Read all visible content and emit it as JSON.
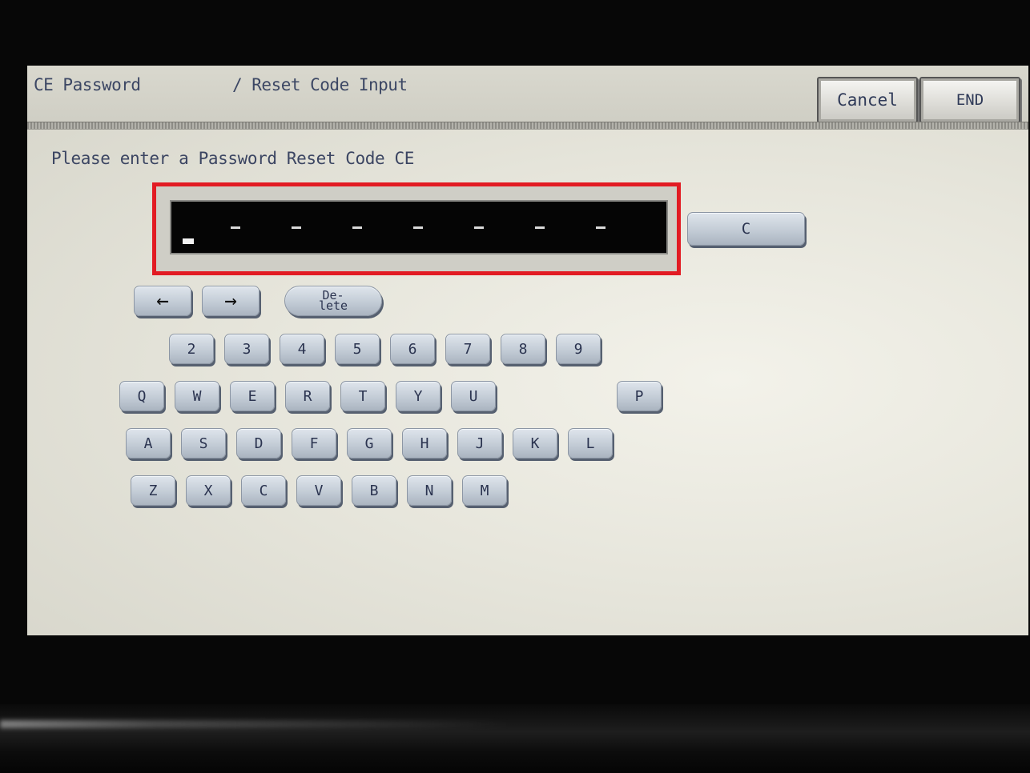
{
  "header": {
    "crumb_primary": "CE Password",
    "crumb_secondary": "/ Reset Code Input",
    "cancel_label": "Cancel",
    "end_label": "END"
  },
  "prompt": "Please enter a Password Reset Code CE",
  "code_input": {
    "slot_char": "-",
    "cursor": "_"
  },
  "controls": {
    "clear_label": "C",
    "left_arrow": "←",
    "right_arrow": "→",
    "delete_line1": "De-",
    "delete_line2": "lete"
  },
  "keyboard": {
    "digits": [
      "2",
      "3",
      "4",
      "5",
      "6",
      "7",
      "8",
      "9"
    ],
    "row_q": [
      "Q",
      "W",
      "E",
      "R",
      "T",
      "Y",
      "U",
      "P"
    ],
    "row_a": [
      "A",
      "S",
      "D",
      "F",
      "G",
      "H",
      "J",
      "K",
      "L"
    ],
    "row_z": [
      "Z",
      "X",
      "C",
      "V",
      "B",
      "N",
      "M"
    ]
  },
  "colors": {
    "highlight_frame": "#e21b23",
    "key_face": "#c3ccd6",
    "screen_bg": "#e7e6dc"
  }
}
